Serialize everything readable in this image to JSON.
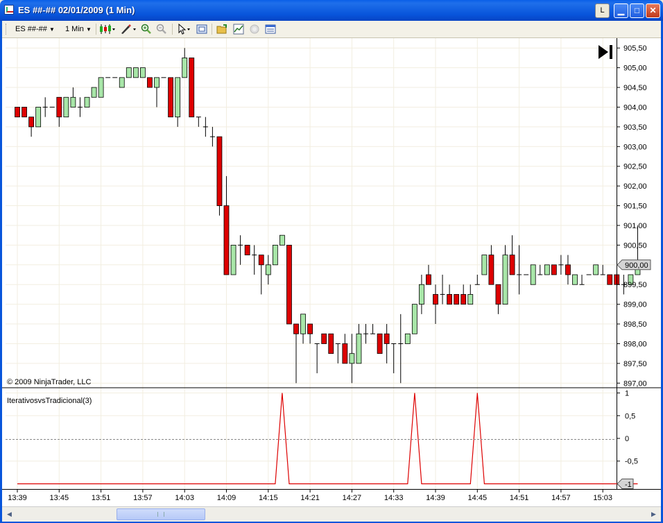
{
  "window": {
    "title": "ES ##-##  02/01/2009 (1 Min)",
    "l_button": "L"
  },
  "toolbar": {
    "instrument": "ES ##-##",
    "interval": "1 Min"
  },
  "chart_labels": {
    "copyright": "© 2009 NinjaTrader, LLC",
    "indicator": "IterativosvsTradicional(3)",
    "last_price": "900,00",
    "last_indicator": "-1"
  },
  "colors": {
    "up": "#A8E6A8",
    "down": "#DD0000",
    "indicator_line": "#DD0000",
    "price_tag": "#D4D4D4"
  },
  "chart_data": [
    {
      "type": "candlestick",
      "x_ticks": [
        "13:39",
        "13:45",
        "13:51",
        "13:57",
        "14:03",
        "14:09",
        "14:15",
        "14:21",
        "14:27",
        "14:33",
        "14:39",
        "14:45",
        "14:51",
        "14:57",
        "15:03"
      ],
      "first_bar_time": "13:39",
      "y_ticks": [
        "905,50",
        "905,00",
        "904,50",
        "904,00",
        "903,50",
        "903,00",
        "902,50",
        "902,00",
        "901,50",
        "901,00",
        "900,50",
        "900,00",
        "899,50",
        "899,00",
        "898,50",
        "898,00",
        "897,50",
        "897,00"
      ],
      "ylim": [
        896.9,
        905.75
      ],
      "bars": [
        [
          904.0,
          904.0,
          903.75,
          903.75
        ],
        [
          904.0,
          904.0,
          903.75,
          903.75
        ],
        [
          903.75,
          903.75,
          903.25,
          903.5
        ],
        [
          903.5,
          904.0,
          903.5,
          904.0
        ],
        [
          904.0,
          904.25,
          903.75,
          904.0
        ],
        [
          904.0,
          904.0,
          904.0,
          904.0
        ],
        [
          904.25,
          904.25,
          903.5,
          903.75
        ],
        [
          903.75,
          904.25,
          903.75,
          904.25
        ],
        [
          904.0,
          904.5,
          904.0,
          904.25
        ],
        [
          904.0,
          904.25,
          903.75,
          904.0
        ],
        [
          904.0,
          904.25,
          904.0,
          904.25
        ],
        [
          904.25,
          904.5,
          904.25,
          904.5
        ],
        [
          904.25,
          904.75,
          904.25,
          904.75
        ],
        [
          904.75,
          904.75,
          904.75,
          904.75
        ],
        [
          904.75,
          904.75,
          904.75,
          904.75
        ],
        [
          904.5,
          904.75,
          904.5,
          904.75
        ],
        [
          904.75,
          905.0,
          904.75,
          905.0
        ],
        [
          904.75,
          905.0,
          904.75,
          905.0
        ],
        [
          904.75,
          905.0,
          904.75,
          905.0
        ],
        [
          904.75,
          904.75,
          904.5,
          904.5
        ],
        [
          904.5,
          904.75,
          904.0,
          904.75
        ],
        [
          904.75,
          904.75,
          904.75,
          904.75
        ],
        [
          904.75,
          904.75,
          903.75,
          903.75
        ],
        [
          903.75,
          904.75,
          903.5,
          904.75
        ],
        [
          904.75,
          905.5,
          904.75,
          905.25
        ],
        [
          905.25,
          905.25,
          903.75,
          903.75
        ],
        [
          903.75,
          903.75,
          903.5,
          903.75
        ],
        [
          903.5,
          903.75,
          903.25,
          903.5
        ],
        [
          903.25,
          903.5,
          903.0,
          903.25
        ],
        [
          903.25,
          903.25,
          901.25,
          901.5
        ],
        [
          901.5,
          902.25,
          899.75,
          899.75
        ],
        [
          899.75,
          900.5,
          899.75,
          900.5
        ],
        [
          900.5,
          900.75,
          900.0,
          900.5
        ],
        [
          900.5,
          900.5,
          900.25,
          900.25
        ],
        [
          900.25,
          900.5,
          899.75,
          900.25
        ],
        [
          900.25,
          900.25,
          899.25,
          900.0
        ],
        [
          899.75,
          900.25,
          899.5,
          900.0
        ],
        [
          900.0,
          900.5,
          900.0,
          900.5
        ],
        [
          900.5,
          900.75,
          900.5,
          900.75
        ],
        [
          900.5,
          900.5,
          898.5,
          898.5
        ],
        [
          898.5,
          898.5,
          897.0,
          898.25
        ],
        [
          898.25,
          898.75,
          898.0,
          898.75
        ],
        [
          898.5,
          898.5,
          898.0,
          898.25
        ],
        [
          898.0,
          898.0,
          897.25,
          898.0
        ],
        [
          898.25,
          898.25,
          898.0,
          898.0
        ],
        [
          898.25,
          898.25,
          897.75,
          897.75
        ],
        [
          898.0,
          898.0,
          897.5,
          898.0
        ],
        [
          898.0,
          898.25,
          897.5,
          897.5
        ],
        [
          897.5,
          898.25,
          897.0,
          897.75
        ],
        [
          897.5,
          898.5,
          897.5,
          898.25
        ],
        [
          898.25,
          898.5,
          898.0,
          898.25
        ],
        [
          898.25,
          898.5,
          898.25,
          898.25
        ],
        [
          898.25,
          898.25,
          897.75,
          897.75
        ],
        [
          898.25,
          898.5,
          897.5,
          898.0
        ],
        [
          898.0,
          898.0,
          897.25,
          898.0
        ],
        [
          898.0,
          898.75,
          897.0,
          898.0
        ],
        [
          898.0,
          898.25,
          898.0,
          898.25
        ],
        [
          898.25,
          899.0,
          898.25,
          899.0
        ],
        [
          899.0,
          899.75,
          898.75,
          899.5
        ],
        [
          899.75,
          900.0,
          899.5,
          899.5
        ],
        [
          899.25,
          899.5,
          898.5,
          899.0
        ],
        [
          899.25,
          899.75,
          899.0,
          899.25
        ],
        [
          899.25,
          899.5,
          899.0,
          899.0
        ],
        [
          899.25,
          899.25,
          899.0,
          899.0
        ],
        [
          899.25,
          899.5,
          899.0,
          899.0
        ],
        [
          899.0,
          899.5,
          899.0,
          899.25
        ],
        [
          899.5,
          899.75,
          899.5,
          899.5
        ],
        [
          899.75,
          900.25,
          899.75,
          900.25
        ],
        [
          900.25,
          900.5,
          899.5,
          899.5
        ],
        [
          899.5,
          899.5,
          898.75,
          899.0
        ],
        [
          899.0,
          900.5,
          899.0,
          900.25
        ],
        [
          900.25,
          900.75,
          899.75,
          899.75
        ],
        [
          899.75,
          900.5,
          899.25,
          899.75
        ],
        [
          899.75,
          899.75,
          899.75,
          899.75
        ],
        [
          899.5,
          900.0,
          899.5,
          900.0
        ],
        [
          899.75,
          900.0,
          899.75,
          899.75
        ],
        [
          899.75,
          900.0,
          899.75,
          900.0
        ],
        [
          900.0,
          900.0,
          899.75,
          899.75
        ],
        [
          900.0,
          900.25,
          899.75,
          900.0
        ],
        [
          900.0,
          900.25,
          899.5,
          899.75
        ],
        [
          899.5,
          899.75,
          899.5,
          899.75
        ],
        [
          899.5,
          899.75,
          899.5,
          899.5
        ],
        [
          899.75,
          899.75,
          899.75,
          899.75
        ],
        [
          899.75,
          900.0,
          899.75,
          900.0
        ],
        [
          899.75,
          900.0,
          899.75,
          899.75
        ],
        [
          899.75,
          899.75,
          899.5,
          899.5
        ],
        [
          899.75,
          899.75,
          899.5,
          899.5
        ],
        [
          899.5,
          899.75,
          899.25,
          899.5
        ],
        [
          899.5,
          899.75,
          899.5,
          899.75
        ],
        [
          899.75,
          901.0,
          899.75,
          900.0
        ]
      ]
    },
    {
      "type": "line",
      "name": "IterativosvsTradicional(3)",
      "y_ticks": [
        "1",
        "0,5",
        "0",
        "-0,5",
        "-1"
      ],
      "ylim": [
        -1.1,
        1.1
      ],
      "spikes_at_bar": [
        38,
        57,
        66
      ],
      "baseline": -1,
      "peak": 1
    }
  ]
}
